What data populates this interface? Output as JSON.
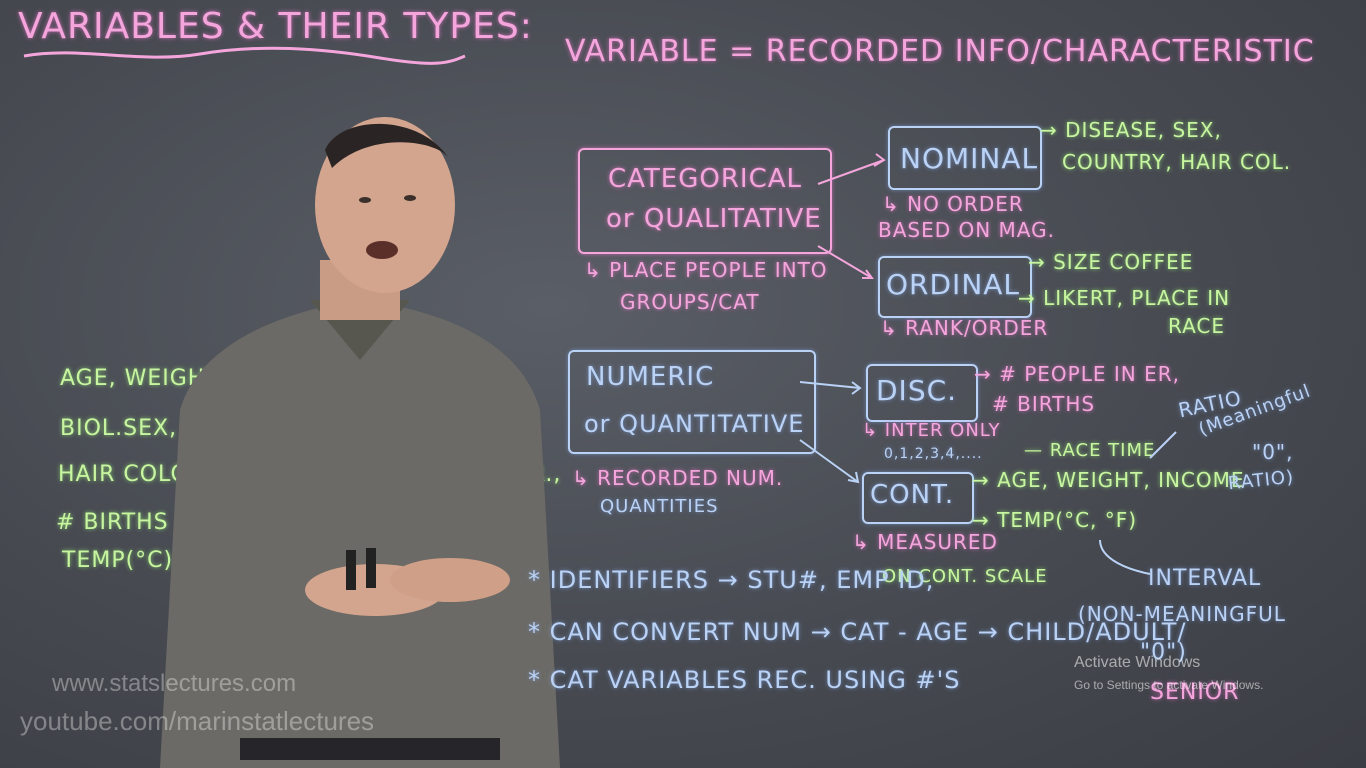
{
  "title": "VARIABLES & THEIR TYPES:",
  "definition": "VARIABLE = RECORDED INFO/CHARACTERISTIC",
  "categorical": {
    "box_line1": "CATEGORICAL",
    "box_line2": "or QUALITATIVE",
    "note_line1": "↳ PLACE PEOPLE INTO",
    "note_line2": "GROUPS/CAT",
    "nominal": "NOMINAL",
    "nominal_examples_line1": "→ DISEASE, SEX,",
    "nominal_examples_line2": "COUNTRY, HAIR COL.",
    "nominal_note_line1": "↳ NO ORDER",
    "nominal_note_line2": "BASED ON MAG.",
    "ordinal": "ORDINAL",
    "ordinal_examples_1": "→ SIZE COFFEE",
    "ordinal_examples_2": "→ LIKERT, PLACE IN",
    "ordinal_examples_3": "RACE",
    "ordinal_note": "↳ RANK/ORDER"
  },
  "numeric": {
    "box_line1": "NUMERIC",
    "box_line2": "or QUANTITATIVE",
    "note_line1": "↳ RECORDED NUM.",
    "note_line2": "QUANTITIES",
    "discrete": "DISC.",
    "discrete_examples_1": "→ # PEOPLE IN ER,",
    "discrete_examples_2": "# BIRTHS",
    "discrete_note_1": "↳ INTER ONLY",
    "discrete_note_2": "0,1,2,3,4,....",
    "continuous": "CONT.",
    "race_time": "— RACE TIME",
    "cont_examples_1": "→ AGE, WEIGHT, INCOME",
    "cont_examples_2": "→ TEMP(°C, °F)",
    "cont_note_1": "↳ MEASURED",
    "cont_note_2": "ON CONT. SCALE",
    "ratio_line1": "RATIO",
    "ratio_line2": "(Meaningful",
    "ratio_line3": "\"0\",",
    "ratio_line4": "RATIO)",
    "interval_line1": "INTERVAL",
    "interval_line2": "(NON-MEANINGFUL",
    "interval_line3": "\"0\")"
  },
  "examples_list": [
    "AGE, WEIGHT, BMI, DISEASE(Y/N)",
    "BIOL.SEX, COUNTRY BIRTH,",
    "HAIR COLOUR, INCOME, # PEOPLE IN E.R.,",
    "# BIRTHS IN DAY, SIZE COFFEE(S/M/L),",
    "TEMP(°C)"
  ],
  "notes": [
    "* IDENTIFIERS → STU#, EMP ID,",
    "* CAN CONVERT NUM → CAT - AGE → CHILD/ADULT/",
    "* CAT VARIABLES REC. USING #'S"
  ],
  "senior": "SENIOR",
  "watermark_1": "www.statslectures.com",
  "watermark_2": "youtube.com/marinstatlectures",
  "activate_1": "Activate Windows",
  "activate_2": "Go to Settings to activate Windows."
}
